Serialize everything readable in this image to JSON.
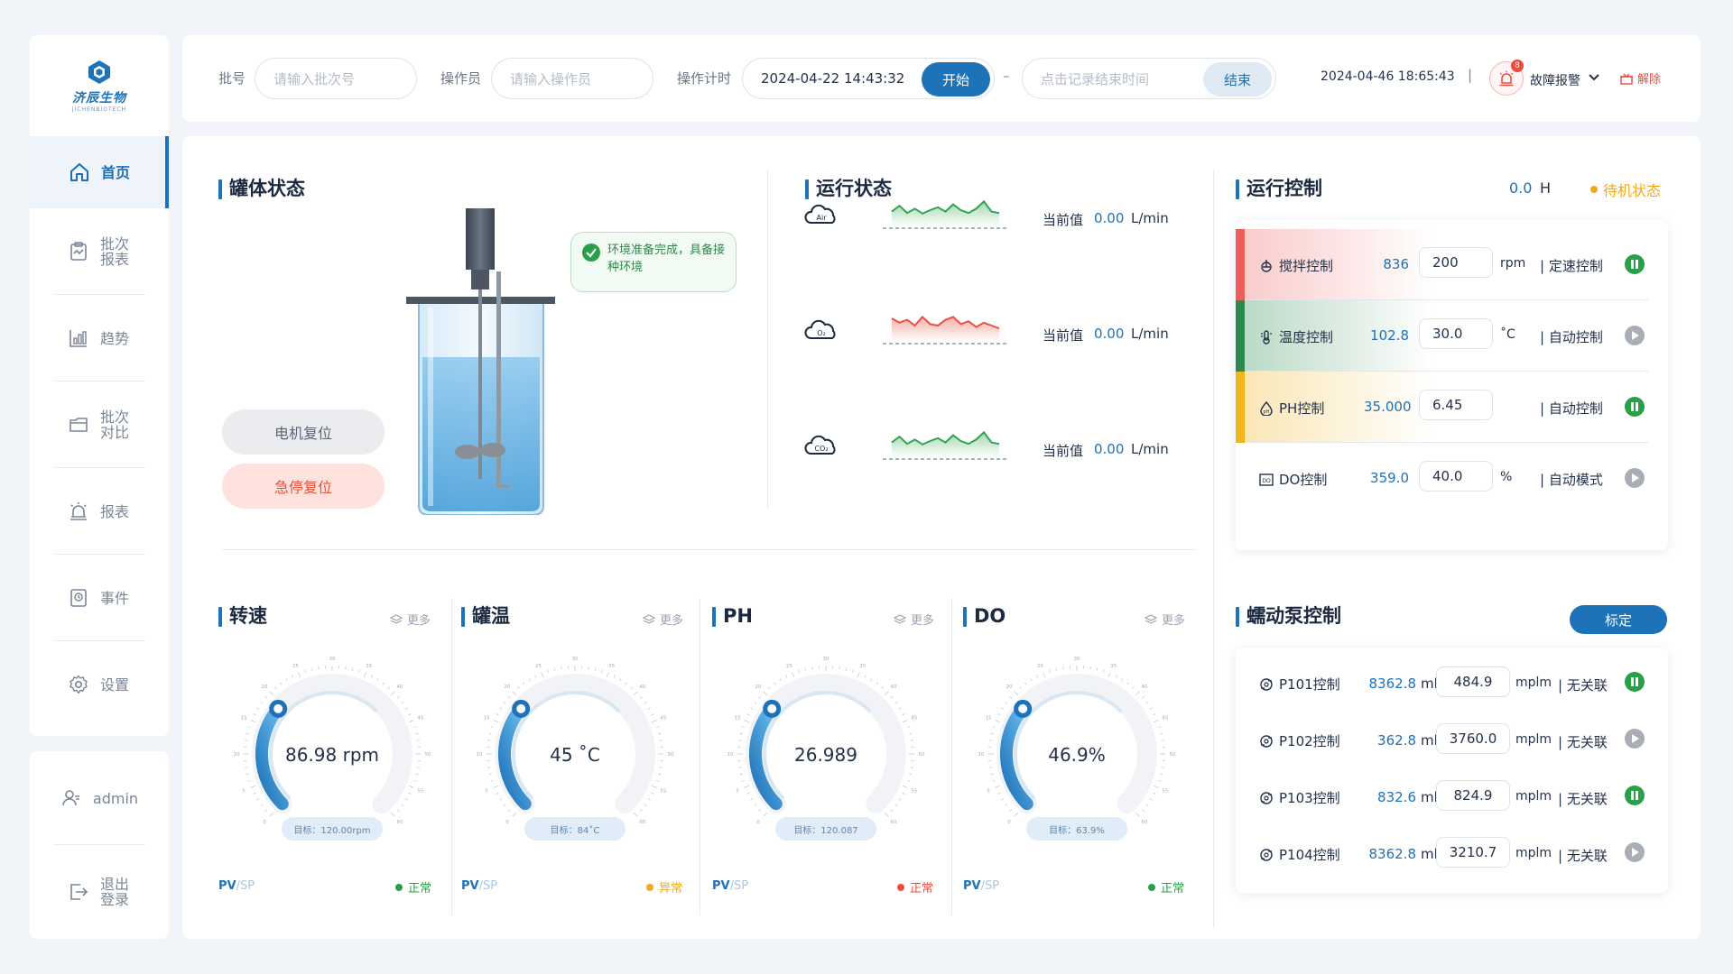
{
  "brand": {
    "name": "济辰生物",
    "sub": "JICHENBIOTECH"
  },
  "sidebar": {
    "items": [
      {
        "label": "首页"
      },
      {
        "label": "批次报表"
      },
      {
        "label": "趋势"
      },
      {
        "label": "批次对比"
      },
      {
        "label": "报表"
      },
      {
        "label": "事件"
      },
      {
        "label": "设置"
      }
    ],
    "user": "admin",
    "logout": "退出登录"
  },
  "topbar": {
    "batch_label": "批号",
    "batch_placeholder": "请输入批次号",
    "operator_label": "操作员",
    "operator_placeholder": "请输入操作员",
    "timer_label": "操作计时",
    "start_time": "2024-04-22 14:43:32",
    "start_btn": "开始",
    "dash": "–",
    "end_placeholder": "点击记录结束时间",
    "end_btn": "结束",
    "clock": "2024-04-46 18:65:43",
    "sep": "|",
    "alarm_count": "8",
    "alarm_label": "故障报警",
    "release_label": "解除"
  },
  "tank": {
    "title": "罐体状态",
    "notice": "环境准备完成，具备接种环境",
    "motor_reset": "电机复位",
    "estop_reset": "急停复位"
  },
  "run_status": {
    "title": "运行状态",
    "rows": [
      {
        "gas": "Air",
        "label": "当前值",
        "value": "0.00",
        "unit": "L/min",
        "color": "#2fa44f"
      },
      {
        "gas": "O₂",
        "label": "当前值",
        "value": "0.00",
        "unit": "L/min",
        "color": "#e8503f"
      },
      {
        "gas": "CO₂",
        "label": "当前值",
        "value": "0.00",
        "unit": "L/min",
        "color": "#2fa44f"
      }
    ]
  },
  "run_control": {
    "title": "运行控制",
    "hours": "0.0",
    "hours_unit": "H",
    "state": "待机状态",
    "rows": [
      {
        "name": "搅拌控制",
        "value": "836",
        "setpoint": "200",
        "unit": "rpm",
        "mode": "| 定速控制",
        "running": true,
        "accent": "#ee5f5b"
      },
      {
        "name": "温度控制",
        "value": "102.8",
        "setpoint": "30.0",
        "unit": "˚C",
        "mode": "| 自动控制",
        "running": false,
        "accent": "#2b8a4e"
      },
      {
        "name": "PH控制",
        "value": "35.000",
        "setpoint": "6.45",
        "unit": "",
        "mode": "| 自动控制",
        "running": true,
        "accent": "#f0b41c"
      },
      {
        "name": "DO控制",
        "value": "359.0",
        "setpoint": "40.0",
        "unit": "%",
        "mode": "| 自动模式",
        "running": false,
        "accent": ""
      }
    ]
  },
  "gauges": [
    {
      "title": "转速",
      "more": "更多",
      "display": "86.98 rpm",
      "target": "目标：120.00rpm",
      "fraction": 0.05,
      "status": "正常",
      "status_color": "#27a048"
    },
    {
      "title": "罐温",
      "more": "更多",
      "display": "45 ˚C",
      "target": "目标：84˚C",
      "fraction": 0.05,
      "status": "异常",
      "status_color": "#f2a81d"
    },
    {
      "title": "PH",
      "more": "更多",
      "display": "26.989",
      "target": "目标：120.087",
      "fraction": 0.05,
      "status": "正常",
      "status_color": "#ef4b3c"
    },
    {
      "title": "DO",
      "more": "更多",
      "display": "46.9%",
      "target": "目标：63.9%",
      "fraction": 0.05,
      "status": "正常",
      "status_color": "#27a048"
    }
  ],
  "gauge_common": {
    "pv": "PV",
    "sp": "/SP",
    "ticks": [
      "0",
      "5",
      "10",
      "15",
      "20",
      "25",
      "30",
      "35",
      "40",
      "45",
      "50",
      "55",
      "60"
    ]
  },
  "pumps": {
    "title": "蠕动泵控制",
    "calibrate": "标定",
    "rows": [
      {
        "name": "P101控制",
        "value": "8362.8",
        "ml": "ml",
        "setpoint": "484.9",
        "unit": "mplm",
        "mode": "| 无关联",
        "running": true
      },
      {
        "name": "P102控制",
        "value": "362.8",
        "ml": "ml",
        "setpoint": "3760.0",
        "unit": "mplm",
        "mode": "| 无关联",
        "running": false
      },
      {
        "name": "P103控制",
        "value": "832.6",
        "ml": "ml",
        "setpoint": "824.9",
        "unit": "mplm",
        "mode": "| 无关联",
        "running": true
      },
      {
        "name": "P104控制",
        "value": "8362.8",
        "ml": "ml",
        "setpoint": "3210.7",
        "unit": "mplm",
        "mode": "| 无关联",
        "running": false
      }
    ]
  }
}
